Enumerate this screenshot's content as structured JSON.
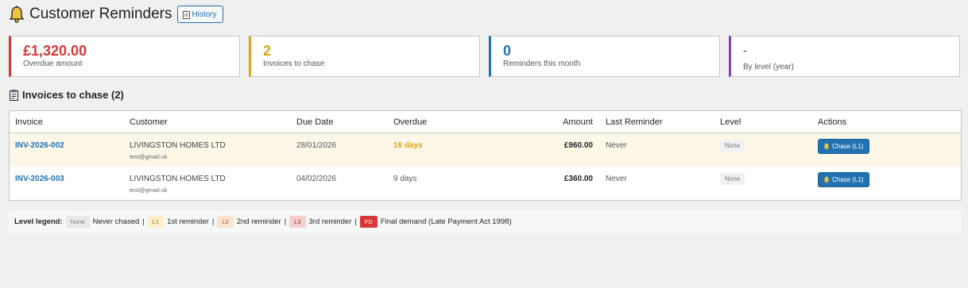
{
  "header": {
    "title": "Customer Reminders",
    "history_label": "History"
  },
  "cards": [
    {
      "value": "£1,320.00",
      "label": "Overdue amount",
      "color": "#d63638"
    },
    {
      "value": "2",
      "label": "Invoices to chase",
      "color": "#dba617"
    },
    {
      "value": "0",
      "label": "Reminders this month",
      "color": "#2271b1"
    },
    {
      "value": "-",
      "label": "By level (year)",
      "color": "#8c3db9"
    }
  ],
  "section": {
    "title": "Invoices to chase (2)"
  },
  "table": {
    "headers": [
      "Invoice",
      "Customer",
      "Due Date",
      "Overdue",
      "Amount",
      "Last Reminder",
      "Level",
      "Actions"
    ],
    "rows": [
      {
        "invoice": "INV-2026-002",
        "customer": "LIVINGSTON HOMES LTD",
        "email": "test@gmail.uk",
        "due": "28/01/2026",
        "overdue": "16 days",
        "amount": "£960.00",
        "last": "Never",
        "level": "None",
        "action": "Chase (L1)"
      },
      {
        "invoice": "INV-2026-003",
        "customer": "LIVINGSTON HOMES LTD",
        "email": "test@gmail.uk",
        "due": "04/02/2026",
        "overdue": "9 days",
        "amount": "£360.00",
        "last": "Never",
        "level": "None",
        "action": "Chase (L1)"
      }
    ]
  },
  "legend": {
    "title": "Level legend:",
    "items": [
      {
        "tag": "None",
        "text": "Never chased"
      },
      {
        "tag": "L1",
        "text": "1st reminder"
      },
      {
        "tag": "L2",
        "text": "2nd reminder"
      },
      {
        "tag": "L3",
        "text": "3rd reminder"
      },
      {
        "tag": "FD",
        "text": "Final demand (Late Payment Act 1998)"
      }
    ],
    "separator": "|"
  },
  "icons": {
    "title_icon": "bell-icon",
    "history_icon": "clipboard-icon",
    "section_icon": "clipboard-icon",
    "action_icon": "bell-icon"
  }
}
